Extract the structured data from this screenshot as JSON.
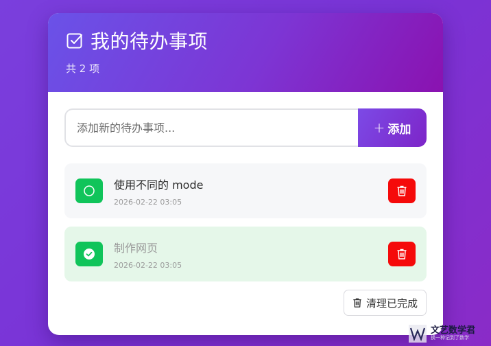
{
  "header": {
    "title": "我的待办事项",
    "count_text": "共 2 项"
  },
  "add": {
    "placeholder": "添加新的待办事项...",
    "button_label": "添加",
    "button_icon": "plus-icon"
  },
  "todos": [
    {
      "title": "使用不同的 mode",
      "date": "2026-02-22 03:05",
      "done": false
    },
    {
      "title": "制作网页",
      "date": "2026-02-22 03:05",
      "done": true
    }
  ],
  "footer": {
    "clear_label": "清理已完成",
    "clear_icon": "trash-icon"
  },
  "watermark": {
    "name": "文艺数学君",
    "tagline": "换一种记到了数学"
  },
  "colors": {
    "accent": "#7a3fdd",
    "header_start": "#6a52e8",
    "header_end": "#8a12b0",
    "check_green": "#10c45a",
    "delete_red": "#f50a0a",
    "done_bg": "#e5f7e9",
    "item_bg": "#f6f7f9"
  }
}
